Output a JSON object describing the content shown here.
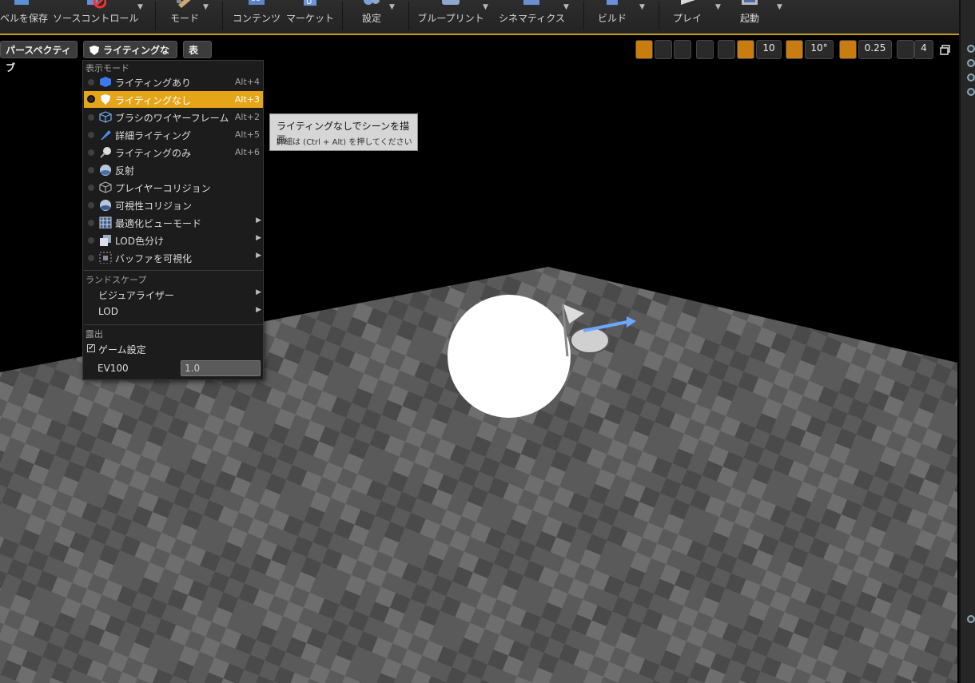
{
  "toolbar": {
    "items": [
      {
        "label": "ベルを保存",
        "icon": "save-level-icon"
      },
      {
        "label": "ソースコントロール",
        "icon": "source-control-icon"
      },
      {
        "label": "モード",
        "icon": "modes-icon"
      },
      {
        "label": "コンテンツ",
        "icon": "content-icon"
      },
      {
        "label": "マーケット",
        "icon": "marketplace-icon"
      },
      {
        "label": "設定",
        "icon": "settings-icon"
      },
      {
        "label": "ブループリント",
        "icon": "blueprint-icon"
      },
      {
        "label": "シネマティクス",
        "icon": "cinematics-icon"
      },
      {
        "label": "ビルド",
        "icon": "build-icon"
      },
      {
        "label": "プレイ",
        "icon": "play-icon"
      },
      {
        "label": "起動",
        "icon": "launch-icon"
      }
    ]
  },
  "viewport": {
    "perspective_label": "パースペクティブ",
    "view_mode_label": "ライティングなし",
    "show_label": "表示",
    "grid_snap": "10",
    "rotation_snap": "10°",
    "scale_snap": "0.25",
    "camera_speed": "4"
  },
  "menu": {
    "section_view_mode": "表示モード",
    "items": [
      {
        "label": "ライティングあり",
        "shortcut": "Alt+4",
        "icon": "lit-cube-icon"
      },
      {
        "label": "ライティングなし",
        "shortcut": "Alt+3",
        "icon": "unlit-shield-icon"
      },
      {
        "label": "ブラシのワイヤーフレーム",
        "shortcut": "Alt+2",
        "icon": "wireframe-cube-icon"
      },
      {
        "label": "詳細ライティング",
        "shortcut": "Alt+5",
        "icon": "detail-lighting-icon"
      },
      {
        "label": "ライティングのみ",
        "shortcut": "Alt+6",
        "icon": "lighting-only-icon"
      },
      {
        "label": "反射",
        "shortcut": "",
        "icon": "reflection-sphere-icon"
      },
      {
        "label": "プレイヤーコリジョン",
        "shortcut": "",
        "icon": "player-collision-icon"
      },
      {
        "label": "可視性コリジョン",
        "shortcut": "",
        "icon": "visibility-collision-icon"
      },
      {
        "label": "最適化ビューモード",
        "shortcut": "",
        "icon": "optimization-grid-icon"
      },
      {
        "label": "LOD色分け",
        "shortcut": "",
        "icon": "lod-coloration-icon"
      },
      {
        "label": "バッファを可視化",
        "shortcut": "",
        "icon": "buffer-visualization-icon"
      }
    ],
    "section_landscape": "ランドスケープ",
    "landscape_items": [
      {
        "label": "ビジュアライザー"
      },
      {
        "label": "LOD"
      }
    ],
    "section_exposure": "露出",
    "game_settings_label": "ゲーム設定",
    "game_settings_checked": "✓",
    "ev100_label": "EV100",
    "ev100_value": "1.0"
  },
  "tooltip": {
    "title": "ライティングなしでシーンを描画",
    "hint": "詳細は (Ctrl + Alt) を押してください"
  },
  "colors": {
    "accent": "#e6a419",
    "toolbar_border": "#c99a1e",
    "active_tool": "#c97d10"
  }
}
